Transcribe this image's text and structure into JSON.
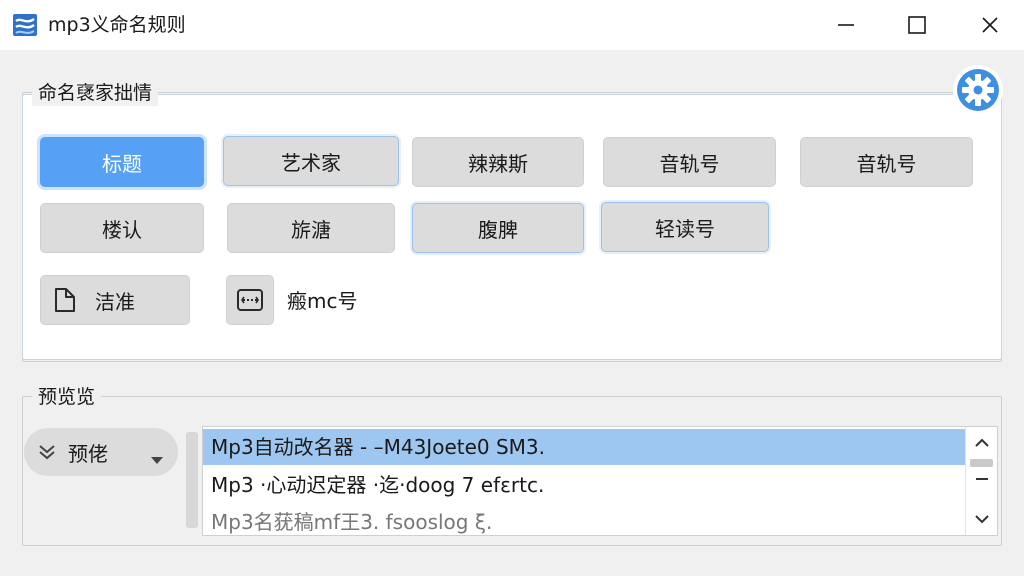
{
  "window": {
    "title": "mp3义命名规则",
    "app_icon": "app-logo-icon",
    "controls": [
      "minimize-icon",
      "maximize-icon",
      "close-icon"
    ]
  },
  "naming_group": {
    "legend": "命名裦家拙情",
    "settings_icon": "gear-icon",
    "accent_color": "#3f8fe0",
    "tags_row1": [
      "标题",
      "艺术家",
      "辣辣斯",
      "音轨号",
      "音轨号"
    ],
    "tags_row2": [
      "楼认",
      "旂溏",
      "腹脾",
      "轻读号"
    ],
    "icon_tags": [
      {
        "label": "洁准",
        "icon": "document-icon"
      },
      {
        "label": "瘢mc号",
        "icon": "separator-icon"
      }
    ]
  },
  "preview_group": {
    "legend": "预览览",
    "dropdown_label": "预佬",
    "dropdown_icon": "double-chevron-down-icon",
    "rows": [
      "Mp3自动改名器  - –M43Joete0 SM3.",
      "Mp3 ·心动迟定器 ·迄·doog 7 efεrtc.",
      "Mp3名莸稿mf王3. fsooslog ξ."
    ],
    "selected_row": 0,
    "selection_color": "#9dc7f0"
  }
}
